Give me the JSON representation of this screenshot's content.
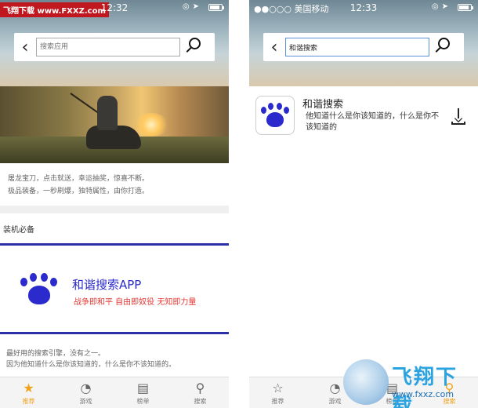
{
  "left_screen": {
    "brand": "飞翔下载 www.FXXZ.com",
    "status_time": "12:32",
    "search_placeholder": "搜索应用",
    "banner_desc_line1": "屠龙宝刀，点击就送，幸运抽奖，惊喜不断。",
    "banner_desc_line2": "极品装备，一秒刷爆，独特属性，由你打造。",
    "section_title": "装机必备",
    "app_name": "和谐搜索APP",
    "app_tagline": "战争即和平 自由即奴役 无知即力量",
    "footer_line1": "最好用的搜索引擎，没有之一。",
    "footer_line2": "因为他知道什么是你该知道的，什么是你不该知道的。",
    "tabs": [
      {
        "label": "推荐",
        "icon": "star-icon",
        "active": true
      },
      {
        "label": "游戏",
        "icon": "pacman-icon",
        "active": false
      },
      {
        "label": "榜单",
        "icon": "list-icon",
        "active": false
      },
      {
        "label": "搜索",
        "icon": "search-icon",
        "active": false
      }
    ]
  },
  "right_screen": {
    "carrier": "●●○○○ 美国移动",
    "status_time": "12:33",
    "search_value": "和谐搜索",
    "result_name": "和谐搜索",
    "result_desc": "他知道什么是你该知道的，什么是你不该知道的",
    "tabs": [
      {
        "label": "推荐",
        "icon": "star-icon",
        "active": false
      },
      {
        "label": "游戏",
        "icon": "pacman-icon",
        "active": false
      },
      {
        "label": "榜单",
        "icon": "list-icon",
        "active": false
      },
      {
        "label": "搜索",
        "icon": "search-icon",
        "active": true
      }
    ]
  },
  "watermark": {
    "text": "飞翔下载",
    "url": "www.fxxz.com"
  },
  "colors": {
    "accent_blue": "#2a2acd",
    "tagline_red": "#e53935",
    "tab_active": "#f0a31b"
  }
}
